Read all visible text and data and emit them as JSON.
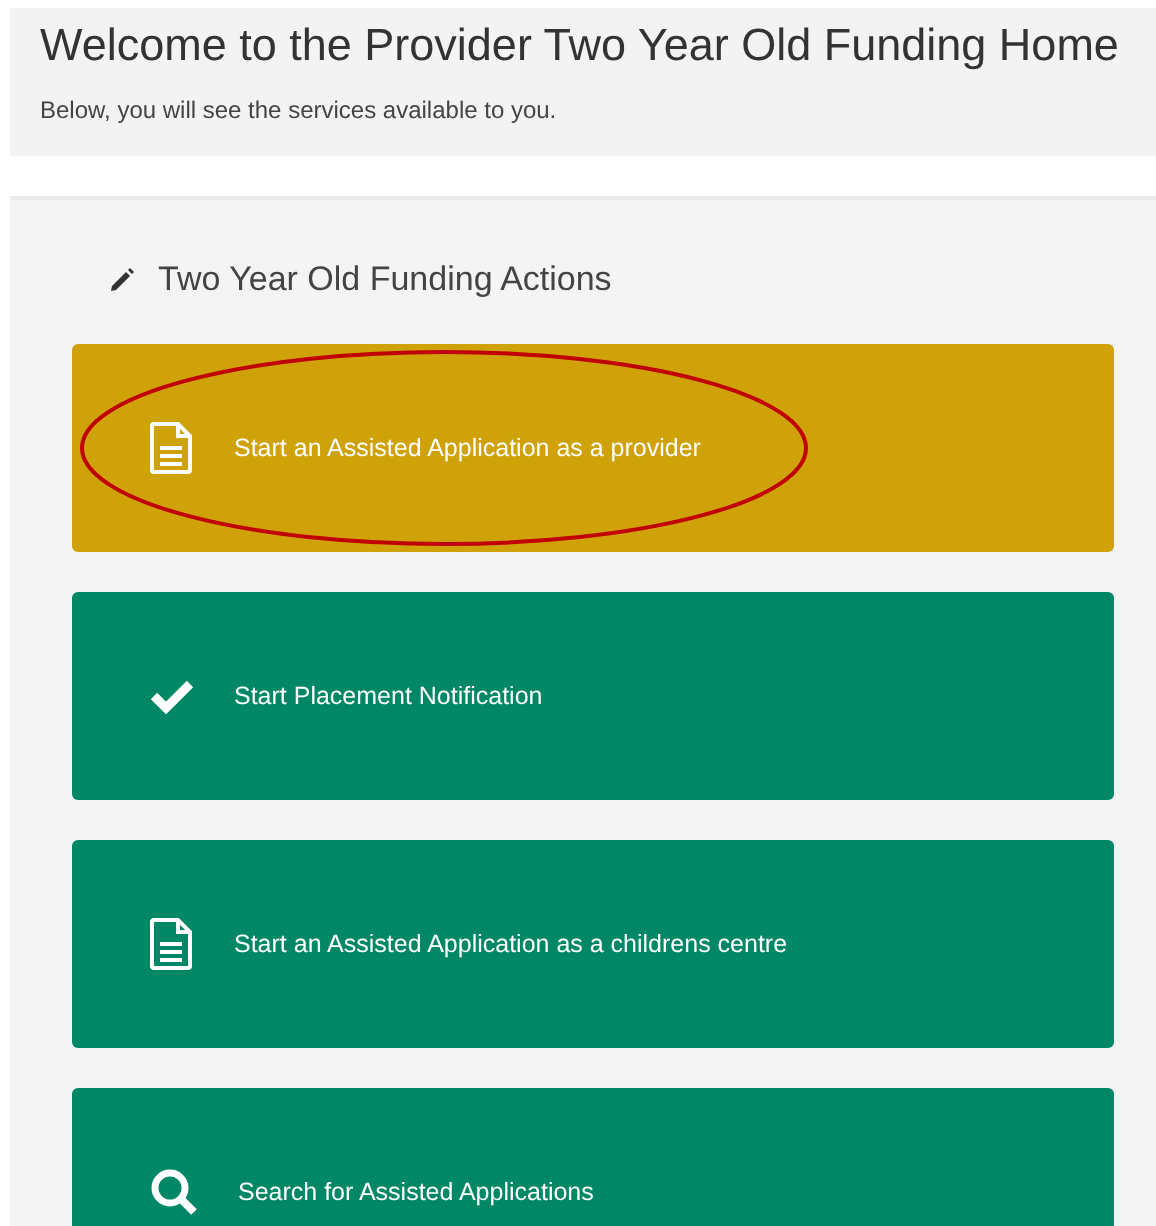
{
  "header": {
    "title": "Welcome to the Provider Two Year Old Funding Home",
    "subtitle": "Below, you will see the services available to you."
  },
  "actions": {
    "heading": "Two Year Old Funding Actions",
    "items": [
      {
        "label": "Start an Assisted Application as a provider",
        "kind": "document",
        "highlighted": true,
        "circled": true
      },
      {
        "label": "Start Placement Notification",
        "kind": "check",
        "highlighted": false,
        "circled": false
      },
      {
        "label": "Start an Assisted Application as a childrens centre",
        "kind": "document",
        "highlighted": false,
        "circled": false
      },
      {
        "label": "Search for Assisted Applications",
        "kind": "search",
        "highlighted": false,
        "circled": false
      }
    ]
  }
}
